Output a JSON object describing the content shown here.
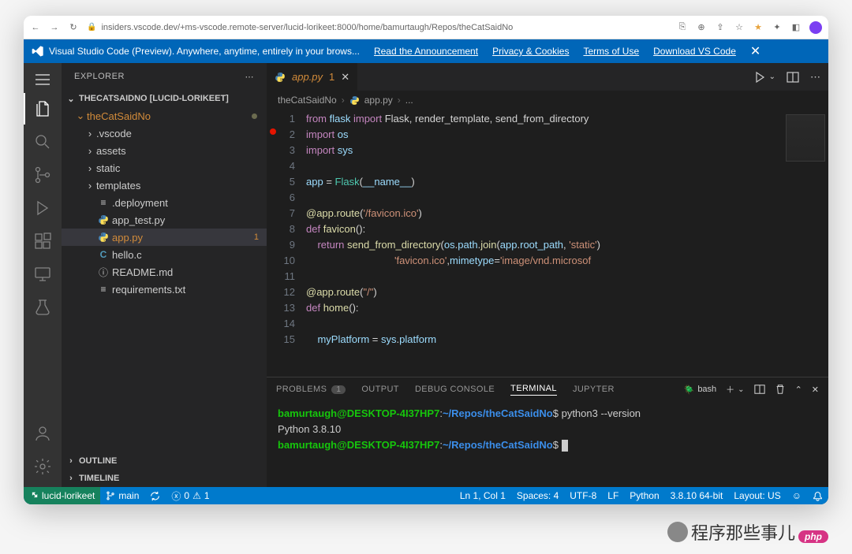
{
  "browser": {
    "url": "insiders.vscode.dev/+ms-vscode.remote-server/lucid-lorikeet:8000/home/bamurtaugh/Repos/theCatSaidNo"
  },
  "banner": {
    "title": "Visual Studio Code (Preview). Anywhere, anytime, entirely in your brows...",
    "links": [
      "Read the Announcement",
      "Privacy & Cookies",
      "Terms of Use",
      "Download VS Code"
    ]
  },
  "sidebar": {
    "title": "EXPLORER",
    "workspace": "THECATSAIDNO [LUCID-LORIKEET]",
    "root": "theCatSaidNo",
    "folders": [
      ".vscode",
      "assets",
      "static",
      "templates"
    ],
    "files": [
      {
        "name": ".deployment",
        "icon": "lines"
      },
      {
        "name": "app_test.py",
        "icon": "py"
      },
      {
        "name": "app.py",
        "icon": "py",
        "selected": true,
        "badge": "1"
      },
      {
        "name": "hello.c",
        "icon": "c"
      },
      {
        "name": "README.md",
        "icon": "info"
      },
      {
        "name": "requirements.txt",
        "icon": "lines"
      }
    ],
    "sections": [
      "OUTLINE",
      "TIMELINE"
    ]
  },
  "tab": {
    "name": "app.py",
    "badge": "1"
  },
  "breadcrumbs": [
    "theCatSaidNo",
    "app.py",
    "..."
  ],
  "code": {
    "lines": [
      {
        "n": 1,
        "t": [
          [
            "kw",
            "from"
          ],
          [
            "op",
            " "
          ],
          [
            "var",
            "flask"
          ],
          [
            "op",
            " "
          ],
          [
            "kw",
            "import"
          ],
          [
            "op",
            " Flask, render_template, send_from_directory"
          ]
        ]
      },
      {
        "n": 2,
        "t": [
          [
            "kw",
            "import"
          ],
          [
            "op",
            " "
          ],
          [
            "var",
            "os"
          ]
        ]
      },
      {
        "n": 3,
        "t": [
          [
            "kw",
            "import"
          ],
          [
            "op",
            " "
          ],
          [
            "var",
            "sys"
          ]
        ]
      },
      {
        "n": 4,
        "t": [
          [
            "op",
            ""
          ]
        ]
      },
      {
        "n": 5,
        "t": [
          [
            "var",
            "app"
          ],
          [
            "op",
            " = "
          ],
          [
            "cls",
            "Flask"
          ],
          [
            "op",
            "("
          ],
          [
            "var",
            "__name__"
          ],
          [
            "op",
            ")"
          ]
        ]
      },
      {
        "n": 6,
        "t": [
          [
            "op",
            ""
          ]
        ]
      },
      {
        "n": 7,
        "t": [
          [
            "dec",
            "@app.route"
          ],
          [
            "op",
            "("
          ],
          [
            "str",
            "'/favicon.ico'"
          ],
          [
            "op",
            ")"
          ]
        ]
      },
      {
        "n": 8,
        "t": [
          [
            "kw",
            "def"
          ],
          [
            "op",
            " "
          ],
          [
            "fn",
            "favicon"
          ],
          [
            "op",
            "():"
          ]
        ]
      },
      {
        "n": 9,
        "t": [
          [
            "op",
            "    "
          ],
          [
            "kw",
            "return"
          ],
          [
            "op",
            " "
          ],
          [
            "fn",
            "send_from_directory"
          ],
          [
            "op",
            "("
          ],
          [
            "var",
            "os"
          ],
          [
            "op",
            "."
          ],
          [
            "var",
            "path"
          ],
          [
            "op",
            "."
          ],
          [
            "fn",
            "join"
          ],
          [
            "op",
            "("
          ],
          [
            "var",
            "app"
          ],
          [
            "op",
            "."
          ],
          [
            "var",
            "root_path"
          ],
          [
            "op",
            ", "
          ],
          [
            "str",
            "'static'"
          ],
          [
            "op",
            ")"
          ]
        ]
      },
      {
        "n": 10,
        "t": [
          [
            "op",
            "                               "
          ],
          [
            "str",
            "'favicon.ico'"
          ],
          [
            "op",
            ","
          ],
          [
            "var",
            "mimetype"
          ],
          [
            "op",
            "="
          ],
          [
            "str",
            "'image/vnd.microsof"
          ]
        ]
      },
      {
        "n": 11,
        "t": [
          [
            "op",
            ""
          ]
        ]
      },
      {
        "n": 12,
        "t": [
          [
            "dec",
            "@app.route"
          ],
          [
            "op",
            "("
          ],
          [
            "str",
            "\"/\""
          ],
          [
            "op",
            ")"
          ]
        ]
      },
      {
        "n": 13,
        "t": [
          [
            "kw",
            "def"
          ],
          [
            "op",
            " "
          ],
          [
            "fn",
            "home"
          ],
          [
            "op",
            "():"
          ]
        ]
      },
      {
        "n": 14,
        "t": [
          [
            "op",
            ""
          ]
        ]
      },
      {
        "n": 15,
        "t": [
          [
            "op",
            "    "
          ],
          [
            "var",
            "myPlatform"
          ],
          [
            "op",
            " = "
          ],
          [
            "var",
            "sys"
          ],
          [
            "op",
            "."
          ],
          [
            "var",
            "platform"
          ]
        ]
      }
    ]
  },
  "panel": {
    "tabs": [
      "PROBLEMS",
      "OUTPUT",
      "DEBUG CONSOLE",
      "TERMINAL",
      "JUPYTER"
    ],
    "active": "TERMINAL",
    "problems_count": "1",
    "shell": "bash",
    "terminal": {
      "user": "bamurtaugh@DESKTOP-4I37HP7",
      "path": "~/Repos/theCatSaidNo",
      "prompt": "$",
      "cmd": "python3 --version",
      "output": "Python 3.8.10"
    }
  },
  "statusbar": {
    "remote": "lucid-lorikeet",
    "branch": "main",
    "errors": "0",
    "warnings": "1",
    "position": "Ln 1, Col 1",
    "spaces": "Spaces: 4",
    "encoding": "UTF-8",
    "eol": "LF",
    "lang": "Python",
    "interp": "3.8.10 64-bit",
    "layout": "Layout: US"
  },
  "caption": "程序那些事儿",
  "php": "php"
}
